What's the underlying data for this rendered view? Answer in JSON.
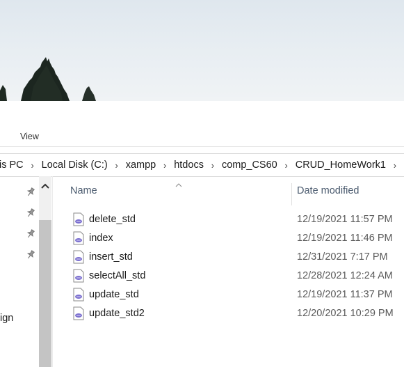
{
  "ribbon": {
    "view_tab": "View"
  },
  "address": {
    "crumbs": [
      "is PC",
      "Local Disk (C:)",
      "xampp",
      "htdocs",
      "comp_CS60",
      "CRUD_HomeWork1"
    ]
  },
  "nav": {
    "partial_label": "ign"
  },
  "columns": {
    "name": "Name",
    "date_modified": "Date modified"
  },
  "files": [
    {
      "name": "delete_std",
      "date": "12/19/2021 11:57 PM"
    },
    {
      "name": "index",
      "date": "12/19/2021 11:46 PM"
    },
    {
      "name": "insert_std",
      "date": "12/31/2021 7:17 PM"
    },
    {
      "name": "selectAll_std",
      "date": "12/28/2021 12:24 AM"
    },
    {
      "name": "update_std",
      "date": "12/19/2021 11:37 PM"
    },
    {
      "name": "update_std2",
      "date": "12/20/2021 10:29 PM"
    }
  ],
  "colors": {
    "header_text": "#4a5a6e",
    "php_icon": "#7b6fd0"
  },
  "icons": [
    "pin-icon",
    "chevron-right-icon",
    "sort-up-icon",
    "scroll-up-icon",
    "php-file-icon"
  ]
}
